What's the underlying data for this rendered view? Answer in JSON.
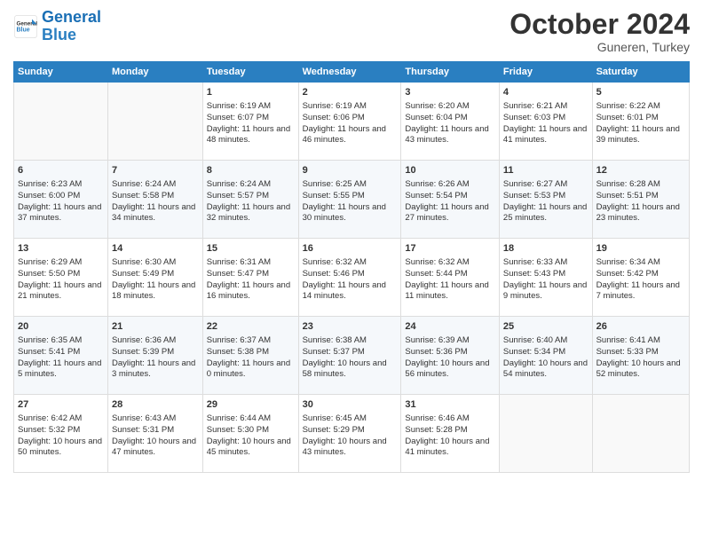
{
  "header": {
    "logo_general": "General",
    "logo_blue": "Blue",
    "month_title": "October 2024",
    "location": "Guneren, Turkey"
  },
  "days_of_week": [
    "Sunday",
    "Monday",
    "Tuesday",
    "Wednesday",
    "Thursday",
    "Friday",
    "Saturday"
  ],
  "weeks": [
    [
      {
        "day": "",
        "content": ""
      },
      {
        "day": "",
        "content": ""
      },
      {
        "day": "1",
        "content": "Sunrise: 6:19 AM\nSunset: 6:07 PM\nDaylight: 11 hours and 48 minutes."
      },
      {
        "day": "2",
        "content": "Sunrise: 6:19 AM\nSunset: 6:06 PM\nDaylight: 11 hours and 46 minutes."
      },
      {
        "day": "3",
        "content": "Sunrise: 6:20 AM\nSunset: 6:04 PM\nDaylight: 11 hours and 43 minutes."
      },
      {
        "day": "4",
        "content": "Sunrise: 6:21 AM\nSunset: 6:03 PM\nDaylight: 11 hours and 41 minutes."
      },
      {
        "day": "5",
        "content": "Sunrise: 6:22 AM\nSunset: 6:01 PM\nDaylight: 11 hours and 39 minutes."
      }
    ],
    [
      {
        "day": "6",
        "content": "Sunrise: 6:23 AM\nSunset: 6:00 PM\nDaylight: 11 hours and 37 minutes."
      },
      {
        "day": "7",
        "content": "Sunrise: 6:24 AM\nSunset: 5:58 PM\nDaylight: 11 hours and 34 minutes."
      },
      {
        "day": "8",
        "content": "Sunrise: 6:24 AM\nSunset: 5:57 PM\nDaylight: 11 hours and 32 minutes."
      },
      {
        "day": "9",
        "content": "Sunrise: 6:25 AM\nSunset: 5:55 PM\nDaylight: 11 hours and 30 minutes."
      },
      {
        "day": "10",
        "content": "Sunrise: 6:26 AM\nSunset: 5:54 PM\nDaylight: 11 hours and 27 minutes."
      },
      {
        "day": "11",
        "content": "Sunrise: 6:27 AM\nSunset: 5:53 PM\nDaylight: 11 hours and 25 minutes."
      },
      {
        "day": "12",
        "content": "Sunrise: 6:28 AM\nSunset: 5:51 PM\nDaylight: 11 hours and 23 minutes."
      }
    ],
    [
      {
        "day": "13",
        "content": "Sunrise: 6:29 AM\nSunset: 5:50 PM\nDaylight: 11 hours and 21 minutes."
      },
      {
        "day": "14",
        "content": "Sunrise: 6:30 AM\nSunset: 5:49 PM\nDaylight: 11 hours and 18 minutes."
      },
      {
        "day": "15",
        "content": "Sunrise: 6:31 AM\nSunset: 5:47 PM\nDaylight: 11 hours and 16 minutes."
      },
      {
        "day": "16",
        "content": "Sunrise: 6:32 AM\nSunset: 5:46 PM\nDaylight: 11 hours and 14 minutes."
      },
      {
        "day": "17",
        "content": "Sunrise: 6:32 AM\nSunset: 5:44 PM\nDaylight: 11 hours and 11 minutes."
      },
      {
        "day": "18",
        "content": "Sunrise: 6:33 AM\nSunset: 5:43 PM\nDaylight: 11 hours and 9 minutes."
      },
      {
        "day": "19",
        "content": "Sunrise: 6:34 AM\nSunset: 5:42 PM\nDaylight: 11 hours and 7 minutes."
      }
    ],
    [
      {
        "day": "20",
        "content": "Sunrise: 6:35 AM\nSunset: 5:41 PM\nDaylight: 11 hours and 5 minutes."
      },
      {
        "day": "21",
        "content": "Sunrise: 6:36 AM\nSunset: 5:39 PM\nDaylight: 11 hours and 3 minutes."
      },
      {
        "day": "22",
        "content": "Sunrise: 6:37 AM\nSunset: 5:38 PM\nDaylight: 11 hours and 0 minutes."
      },
      {
        "day": "23",
        "content": "Sunrise: 6:38 AM\nSunset: 5:37 PM\nDaylight: 10 hours and 58 minutes."
      },
      {
        "day": "24",
        "content": "Sunrise: 6:39 AM\nSunset: 5:36 PM\nDaylight: 10 hours and 56 minutes."
      },
      {
        "day": "25",
        "content": "Sunrise: 6:40 AM\nSunset: 5:34 PM\nDaylight: 10 hours and 54 minutes."
      },
      {
        "day": "26",
        "content": "Sunrise: 6:41 AM\nSunset: 5:33 PM\nDaylight: 10 hours and 52 minutes."
      }
    ],
    [
      {
        "day": "27",
        "content": "Sunrise: 6:42 AM\nSunset: 5:32 PM\nDaylight: 10 hours and 50 minutes."
      },
      {
        "day": "28",
        "content": "Sunrise: 6:43 AM\nSunset: 5:31 PM\nDaylight: 10 hours and 47 minutes."
      },
      {
        "day": "29",
        "content": "Sunrise: 6:44 AM\nSunset: 5:30 PM\nDaylight: 10 hours and 45 minutes."
      },
      {
        "day": "30",
        "content": "Sunrise: 6:45 AM\nSunset: 5:29 PM\nDaylight: 10 hours and 43 minutes."
      },
      {
        "day": "31",
        "content": "Sunrise: 6:46 AM\nSunset: 5:28 PM\nDaylight: 10 hours and 41 minutes."
      },
      {
        "day": "",
        "content": ""
      },
      {
        "day": "",
        "content": ""
      }
    ]
  ]
}
